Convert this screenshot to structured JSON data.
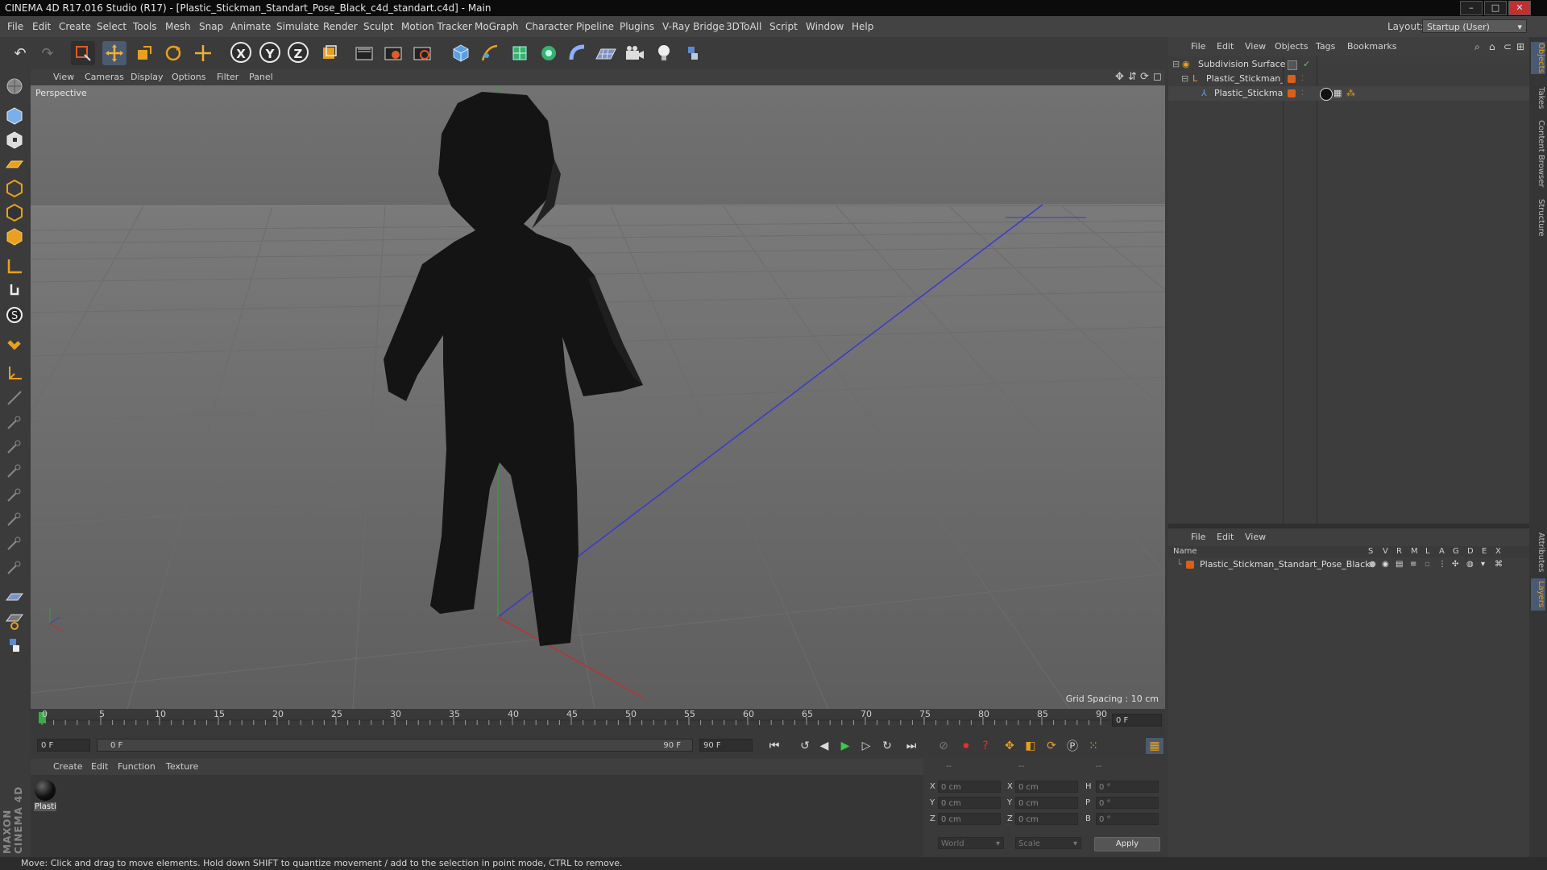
{
  "window": {
    "title": "CINEMA 4D R17.016 Studio (R17) - [Plastic_Stickman_Standart_Pose_Black_c4d_standart.c4d] - Main",
    "min": "–",
    "max": "□",
    "close": "✕"
  },
  "menu": [
    "File",
    "Edit",
    "Create",
    "Select",
    "Tools",
    "Mesh",
    "Snap",
    "Animate",
    "Simulate",
    "Render",
    "Sculpt",
    "Motion Tracker",
    "MoGraph",
    "Character",
    "Pipeline",
    "Plugins",
    "V-Ray Bridge",
    "3DToAll",
    "Script",
    "Window",
    "Help"
  ],
  "layout": {
    "label": "Layout:",
    "value": "Startup (User)"
  },
  "toolbar": {
    "icons": [
      "undo-icon",
      "redo-icon",
      "live-selection-icon",
      "move-icon",
      "scale-icon",
      "rotate-icon",
      "last-tool-icon"
    ],
    "axes": [
      "X",
      "Y",
      "Z"
    ],
    "more": [
      "coordinate-system-icon",
      "render-view-icon",
      "render-picture-viewer-icon",
      "render-settings-icon",
      "cube-icon",
      "pen-icon",
      "subdivision-icon",
      "cloner-icon",
      "deformer-icon",
      "floor-icon",
      "camera-icon",
      "light-icon",
      "python-icon"
    ]
  },
  "viewport": {
    "menus": [
      "View",
      "Cameras",
      "Display",
      "Options",
      "Filter",
      "Panel"
    ],
    "label": "Perspective",
    "grid_spacing": "Grid Spacing : 10 cm"
  },
  "timeline": {
    "ticks": [
      "0",
      "5",
      "10",
      "15",
      "20",
      "25",
      "30",
      "35",
      "40",
      "45",
      "50",
      "55",
      "60",
      "65",
      "70",
      "75",
      "80",
      "85",
      "90"
    ],
    "end_field": "0 F",
    "current": "0 F",
    "range_start": "0 F",
    "range_end": "90 F",
    "max": "90 F"
  },
  "materials": {
    "menus": [
      "Create",
      "Edit",
      "Function",
      "Texture"
    ],
    "items": [
      {
        "label": "Plasti"
      }
    ]
  },
  "coords": {
    "headers": [
      "--",
      "--",
      "--"
    ],
    "rows": [
      {
        "a": "X",
        "av": "0 cm",
        "b": "X",
        "bv": "0 cm",
        "c": "H",
        "cv": "0 °"
      },
      {
        "a": "Y",
        "av": "0 cm",
        "b": "Y",
        "bv": "0 cm",
        "c": "P",
        "cv": "0 °"
      },
      {
        "a": "Z",
        "av": "0 cm",
        "b": "Z",
        "bv": "0 cm",
        "c": "B",
        "cv": "0 °"
      }
    ],
    "world": "World",
    "scale": "Scale",
    "apply": "Apply"
  },
  "status": "Move: Click and drag to move elements. Hold down SHIFT to quantize movement / add to the selection in point mode, CTRL to remove.",
  "objects": {
    "menus": [
      "File",
      "Edit",
      "View",
      "Objects",
      "Tags",
      "Bookmarks"
    ],
    "items": [
      {
        "name": "Subdivision Surface"
      },
      {
        "name": "Plastic_Stickman_S"
      },
      {
        "name": "Plastic_Stickman"
      }
    ]
  },
  "layers": {
    "menus": [
      "File",
      "Edit",
      "View"
    ],
    "columns": [
      "Name",
      "S",
      "V",
      "R",
      "M",
      "L",
      "A",
      "G",
      "D",
      "E",
      "X"
    ],
    "items": [
      {
        "name": "Plastic_Stickman_Standart_Pose_Black"
      }
    ]
  },
  "side_tabs": [
    "Objects",
    "Takes",
    "Content Browser",
    "Structure",
    "Attributes",
    "Layers"
  ],
  "colors": {
    "accent": "#e8a020",
    "layer_orange": "#d8601a",
    "axis_blue": "#3a3acc"
  }
}
